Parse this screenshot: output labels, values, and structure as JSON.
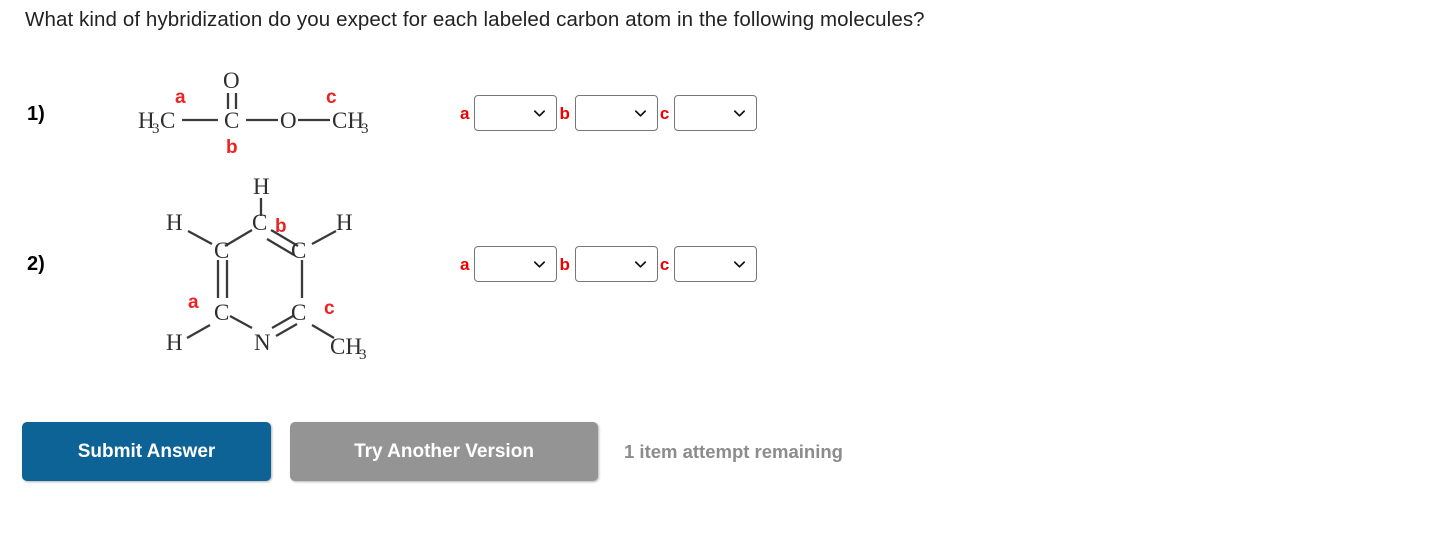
{
  "question": {
    "prompt": "What kind of hybridization do you expect for each labeled carbon atom in the following molecules?"
  },
  "problems": [
    {
      "number": "1)",
      "molecule": {
        "name": "methyl-acetate",
        "atoms": [
          "H",
          "3",
          "C",
          "C",
          "O",
          "O",
          "C",
          "H",
          "3"
        ],
        "formula_parts": {
          "left_methyl": "H",
          "left_methyl_sub": "3",
          "left_methyl_c": "C",
          "carbonyl_c": "C",
          "carbonyl_o": "O",
          "ester_o": "O",
          "right_c": "CH",
          "right_sub": "3"
        },
        "labels": [
          "a",
          "b",
          "c"
        ]
      },
      "answers": [
        {
          "label": "a",
          "value": "",
          "placeholder": ""
        },
        {
          "label": "b",
          "value": "",
          "placeholder": ""
        },
        {
          "label": "c",
          "value": "",
          "placeholder": ""
        }
      ]
    },
    {
      "number": "2)",
      "molecule": {
        "name": "2-methylpyridine",
        "atoms": [
          "H",
          "C",
          "H",
          "C",
          "C",
          "H",
          "C",
          "C",
          "N",
          "C",
          "H",
          "3"
        ],
        "ring_atoms": [
          "C",
          "C",
          "C",
          "C",
          "N",
          "C"
        ],
        "substituents": {
          "top_h": "H",
          "left_upper_h": "H",
          "right_upper_h": "H",
          "left_lower_h": "H",
          "nitrogen": "N",
          "methyl": "CH",
          "methyl_sub": "3"
        },
        "labels": [
          "a",
          "b",
          "c"
        ]
      },
      "answers": [
        {
          "label": "a",
          "value": "",
          "placeholder": ""
        },
        {
          "label": "b",
          "value": "",
          "placeholder": ""
        },
        {
          "label": "c",
          "value": "",
          "placeholder": ""
        }
      ]
    }
  ],
  "footer": {
    "submit_label": "Submit Answer",
    "retry_label": "Try Another Version",
    "attempt_status": "1 item attempt remaining"
  },
  "icons": {
    "chevron": "chevron-down-icon"
  },
  "colors": {
    "submit_blue": "#0d6296",
    "retry_gray": "#949494",
    "label_red": "#ee0000",
    "status_gray": "#8c8c8c",
    "atom_dark": "#2e2e2e"
  }
}
